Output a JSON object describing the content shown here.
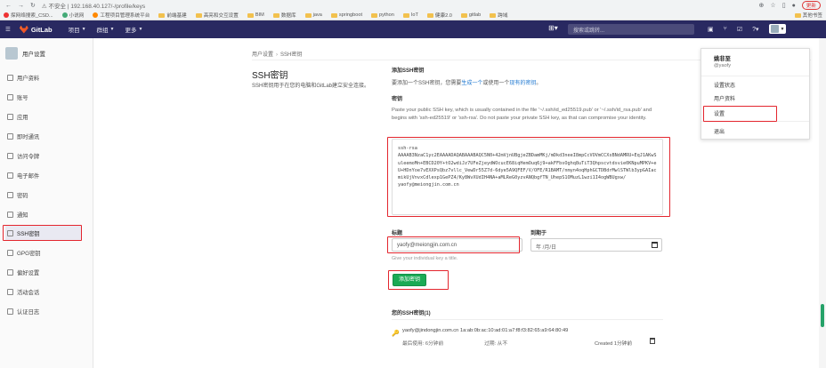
{
  "browser": {
    "security_label": "不安全",
    "url": "192.168.40.127/-/profile/keys",
    "update_label": "更新"
  },
  "bookmarks": {
    "items": [
      "探网络搜索_CSD...",
      "小说网",
      "工程项目管理系统平台",
      "前端基建",
      "高亮和交互设置",
      "BIM",
      "数据库",
      "java",
      "springboot",
      "python",
      "IoT",
      "健康2.0",
      "gitlab",
      "跨域"
    ],
    "other_label": "其他书签"
  },
  "header": {
    "logo": "GitLab",
    "menu": [
      "项目",
      "群组",
      "更多"
    ],
    "search_placeholder": "搜索或跳转..."
  },
  "sidebar": {
    "title": "用户设置",
    "items": [
      "用户资料",
      "账号",
      "应用",
      "即时通讯",
      "访问令牌",
      "电子邮件",
      "密码",
      "通知",
      "SSH密钥",
      "GPG密钥",
      "偏好设置",
      "活动会话",
      "认证日志"
    ]
  },
  "breadcrumb": [
    "用户设置",
    "SSH密钥"
  ],
  "left_panel": {
    "title": "SSH密钥",
    "description": "SSH密钥用于在您的电脑和GitLab建立安全连接。"
  },
  "add_key": {
    "heading": "添加SSH密钥",
    "intro_prefix": "要添加一个SSH密钥，您需要",
    "generate_link": "生成一个",
    "intro_mid": "或使用一个",
    "existing_link": "现有的密钥",
    "key_label": "密钥",
    "help_text": "Paste your public SSH key, which is usually contained in the file '~/.ssh/id_ed25519.pub' or '~/.ssh/id_rsa.pub' and begins with 'ssh-ed25519' or 'ssh-rsa'. Do not paste your private SSH key, as that can compromise your identity.",
    "key_value": "ssh-rsa\nAAAAB3NzaC1yc2EAAAADAQABAAABAQC5N0+42mVjnUBgjeZBDamMKj/mDkd3neeI8mpCcVOVmCCXsBNdAMRU+EqJ1AKwSuleemoMn+EBCD20Y+tO2wdiJz7UFeZjeydWOcucE68iqHemOuq6j9+akFFbsOghq8uTiT3Qhpscvtdsvie0KNpuMPKV+eU+HDnYoe7vEXXPsQbz7vllc_VewDr55Z7d-6dye5A9QFEF/V/OFE/R1BAMT/nmyn4oqHphGCTDBdrMwlSTWlb3ypGAIacmikUjVnvxCdlexp1GePZ4/Ky8WvXUdIH4NA+aMLReG0yzvANQbgfTN_UhepS1OMuzL1wzi1I4ogWBUgxw/\nyaofy@meiongjin.com.cn",
    "title_label": "标题",
    "title_value": "yaofy@meiongjin.com.cn",
    "expires_label": "到期于",
    "date_placeholder": "年 /月/日",
    "hint": "Give your individual key a title.",
    "submit": "添加密钥"
  },
  "your_keys": {
    "heading": "您的SSH密钥(1)",
    "key_title": "yaofy@jindongjin.com.cn",
    "fingerprint": "1a:ab:0b:ac:10:ad:01:a7:f8:f3:82:65:a9:64:80:49",
    "last_used": "最后使用: 6分钟前",
    "expires": "过期: 从不",
    "created": "Created 1分钟前"
  },
  "dropdown": {
    "name": "姚非至",
    "handle": "@yaofy",
    "items": [
      "设置状态",
      "用户资料",
      "设置",
      "退出"
    ]
  },
  "accent_colors": {
    "topbar": "#292961",
    "button": "#1aaa55",
    "highlight": "#e3262e"
  }
}
